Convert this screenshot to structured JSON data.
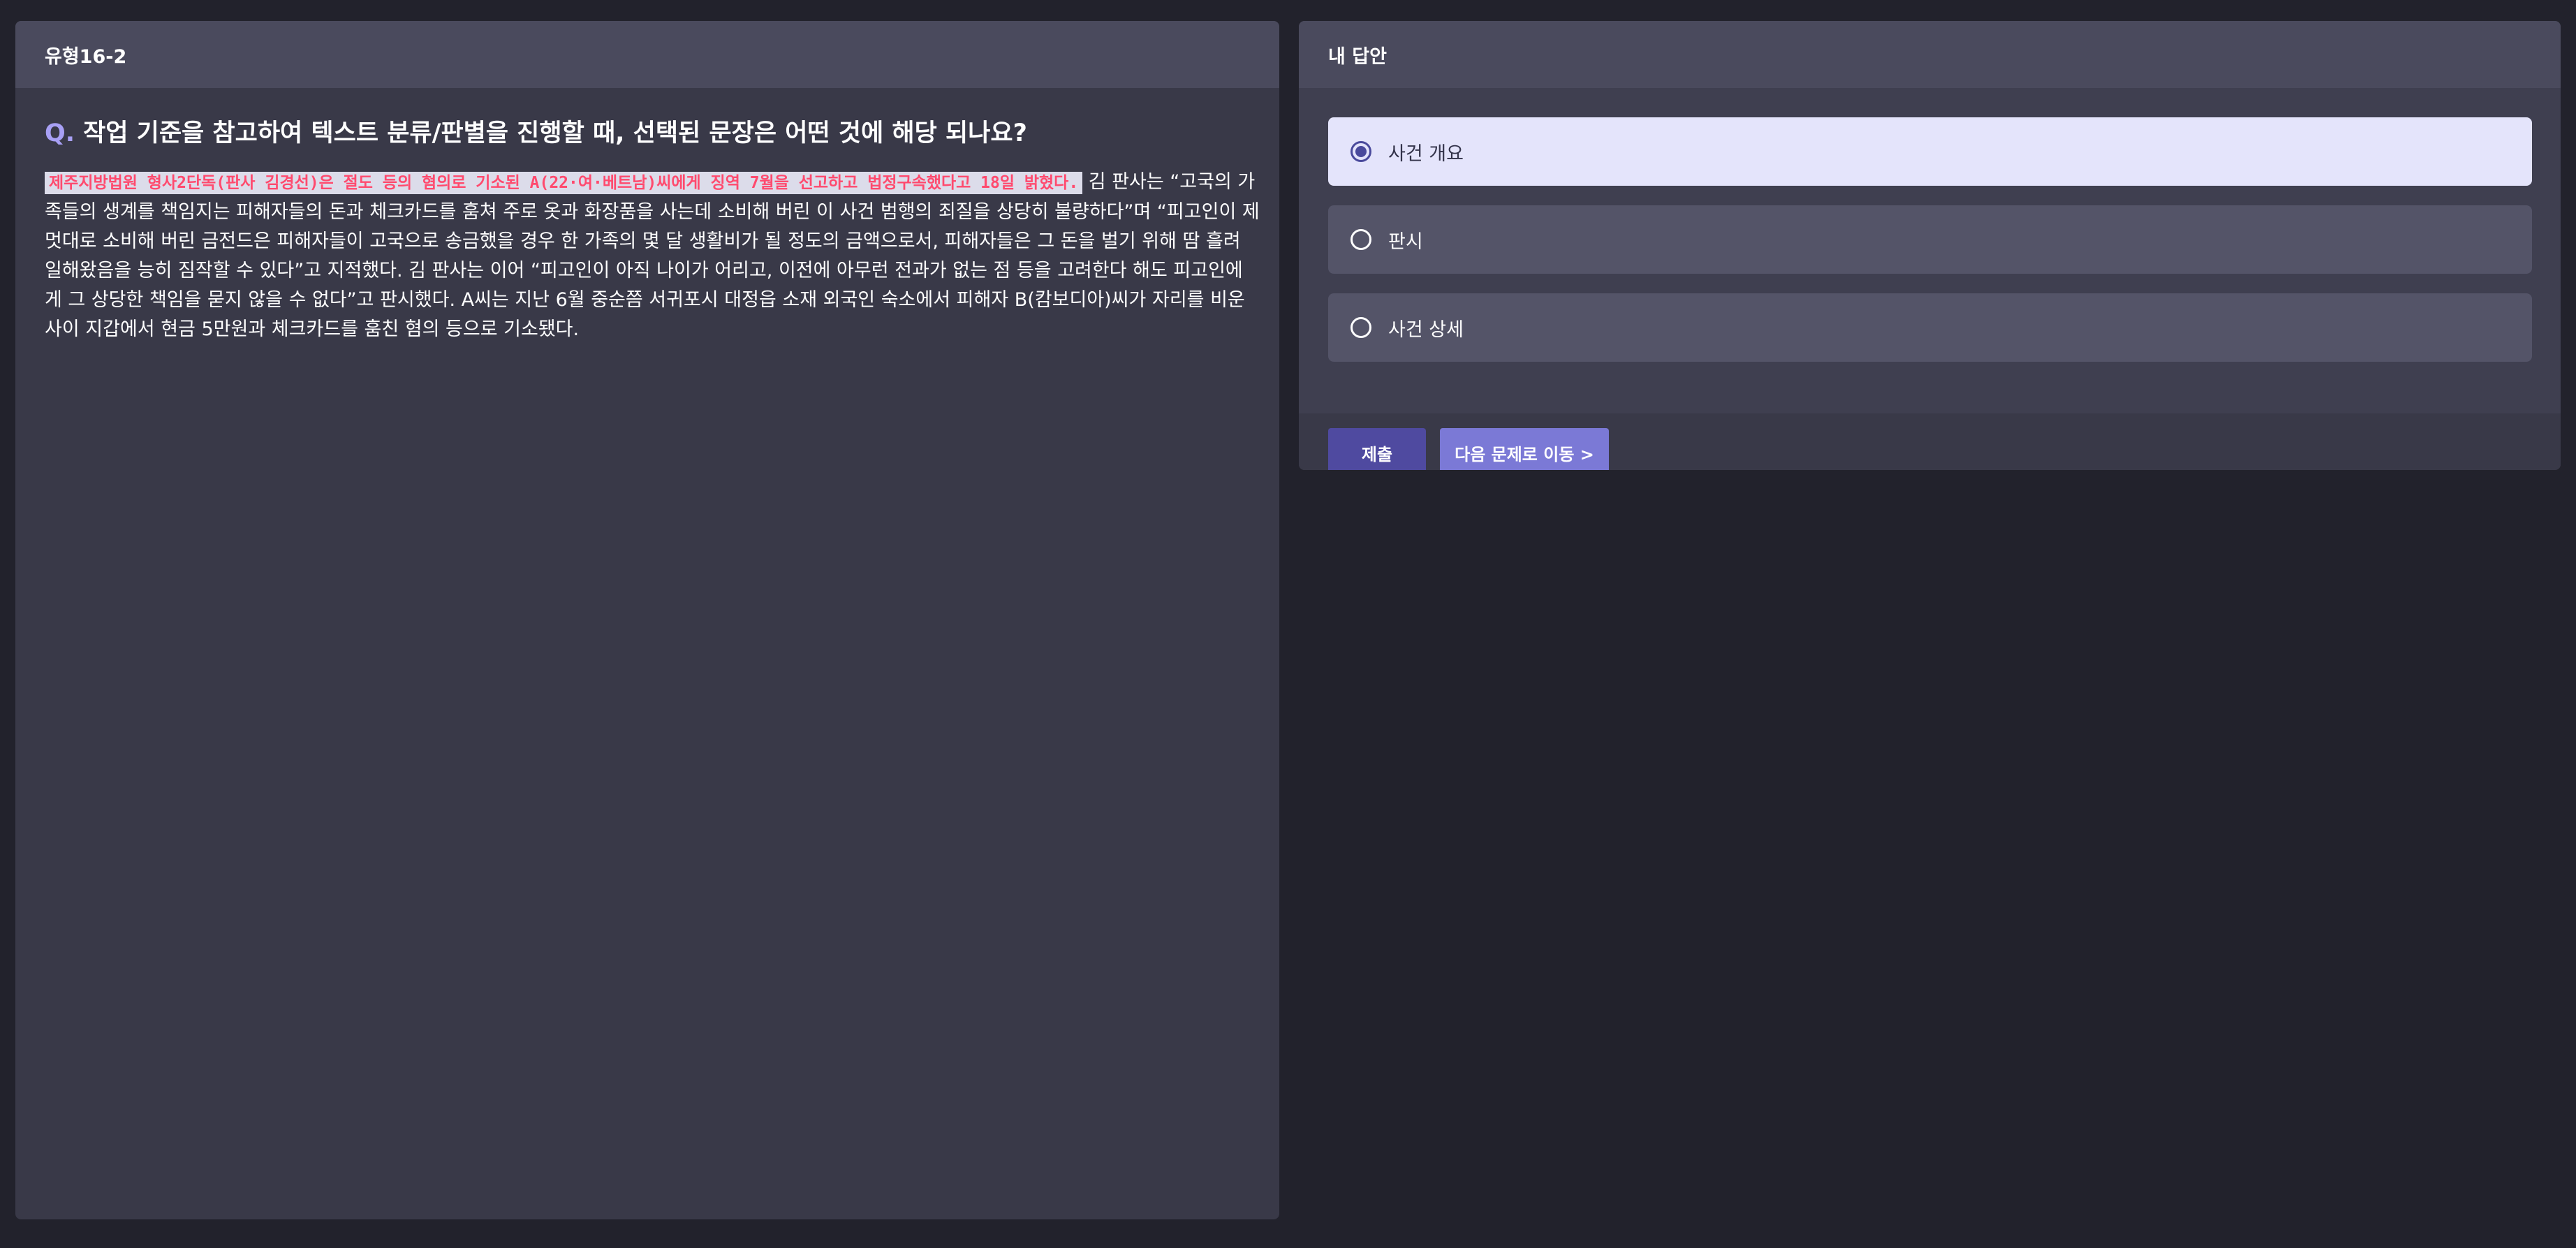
{
  "left_panel": {
    "header_title": "유형16-2",
    "question_prefix": "Q.",
    "question_text": "작업 기준을 참고하여 텍스트 분류/판별을 진행할 때, 선택된 문장은 어떤 것에 해당 되나요?",
    "passage_highlighted": "제주지방법원 형사2단독(판사 김경선)은 절도 등의 혐의로 기소된 A(22·여·베트남)씨에게 징역 7월을 선고하고 법정구속했다고 18일 밝혔다.",
    "passage_rest": "김 판사는 “고국의 가족들의 생계를 책임지는 피해자들의 돈과 체크카드를 훔쳐 주로 옷과 화장품을 사는데 소비해 버린 이 사건 범행의 죄질을 상당히 불량하다”며 “피고인이 제멋대로 소비해 버린 금전드은 피해자들이 고국으로 송금했을 경우 한 가족의 몇 달 생활비가 될 정도의 금액으로서, 피해자들은 그 돈을 벌기 위해 땀 흘려 일해왔음을 능히 짐작할 수 있다”고 지적했다. 김 판사는 이어 “피고인이 아직 나이가 어리고, 이전에 아무런 전과가 없는 점 등을 고려한다 해도 피고인에게 그 상당한 책임을 묻지 않을 수 없다”고 판시했다. A씨는 지난 6월 중순쯤 서귀포시 대정읍 소재 외국인 숙소에서 피해자 B(캄보디아)씨가 자리를 비운 사이 지갑에서 현금 5만원과 체크카드를 훔친 혐의 등으로 기소됐다."
  },
  "right_panel": {
    "header_title": "내 답안",
    "options": [
      {
        "label": "사건 개요",
        "selected": true
      },
      {
        "label": "판시",
        "selected": false
      },
      {
        "label": "사건 상세",
        "selected": false
      }
    ],
    "submit_label": "제출",
    "next_label": "다음 문제로 이동 >"
  },
  "colors": {
    "background": "#22222c",
    "panel": "#393948",
    "panel_header": "#4a4a5d",
    "accent": "#a8a0f5",
    "highlight_text": "#ff4a6e",
    "selected_option": "#e4e4fb",
    "submit_button": "#4f4aa0",
    "next_button": "#7b79d6"
  }
}
